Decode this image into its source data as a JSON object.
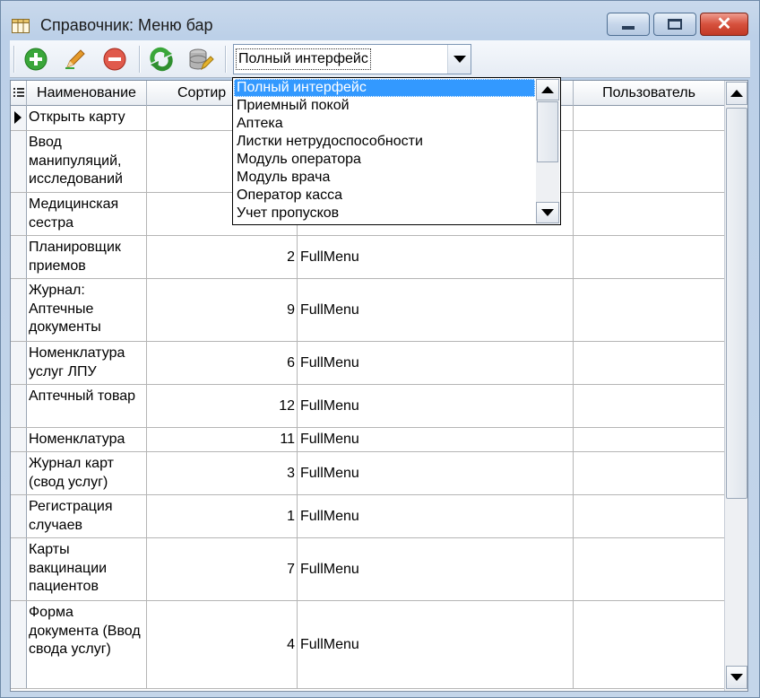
{
  "window": {
    "title": "Справочник: Меню бар",
    "minimize_icon": "minimize-icon",
    "maximize_icon": "maximize-icon",
    "close_icon": "close-icon"
  },
  "toolbar": {
    "buttons": [
      {
        "name": "add-button",
        "icon": "add-icon",
        "color": "#3aa63a"
      },
      {
        "name": "edit-button",
        "icon": "pencil-icon",
        "color": "#e59a2b"
      },
      {
        "name": "delete-button",
        "icon": "delete-icon",
        "color": "#d9392b"
      },
      {
        "name": "refresh-button",
        "icon": "refresh-icon",
        "color": "#3aa63a"
      },
      {
        "name": "filter-button",
        "icon": "database-edit-icon",
        "color": "#8d8d8d"
      }
    ],
    "interface_select": {
      "value": "Полный интерфейс"
    }
  },
  "grid": {
    "columns": [
      "Наименование",
      "Сортир",
      "",
      "Пользователь"
    ],
    "rows": [
      {
        "name": "Открыть карту",
        "sort": "",
        "menu": "",
        "user": "",
        "current": true
      },
      {
        "name": "Ввод манипуляций, исследований",
        "sort": "",
        "menu": "",
        "user": ""
      },
      {
        "name": "Медицинская сестра",
        "sort": "",
        "menu": "",
        "user": ""
      },
      {
        "name": "Планировщик приемов",
        "sort": "2",
        "menu": "FullMenu",
        "user": ""
      },
      {
        "name": "Журнал: Аптечные документы",
        "sort": "9",
        "menu": "FullMenu",
        "user": ""
      },
      {
        "name": "Номенклатура услуг ЛПУ",
        "sort": "6",
        "menu": "FullMenu",
        "user": ""
      },
      {
        "name": "Аптечный товар",
        "sort": "12",
        "menu": "FullMenu",
        "user": ""
      },
      {
        "name": "Номенклатура",
        "sort": "11",
        "menu": "FullMenu",
        "user": ""
      },
      {
        "name": "Журнал карт (свод услуг)",
        "sort": "3",
        "menu": "FullMenu",
        "user": ""
      },
      {
        "name": "Регистрация случаев",
        "sort": "1",
        "menu": "FullMenu",
        "user": ""
      },
      {
        "name": "Карты вакцинации пациентов",
        "sort": "7",
        "menu": "FullMenu",
        "user": ""
      },
      {
        "name": "Форма документа (Ввод свода услуг)",
        "sort": "4",
        "menu": "FullMenu",
        "user": ""
      }
    ]
  },
  "dropdown": {
    "items": [
      "Полный интерфейс",
      "Приемный покой",
      "Аптека",
      "Листки нетрудоспособности",
      "Модуль оператора",
      "Модуль врача",
      "Оператор касса",
      "Учет пропусков"
    ],
    "selected_index": 0
  },
  "colors": {
    "selection": "#3399ff",
    "close_button": "#c23a26"
  }
}
